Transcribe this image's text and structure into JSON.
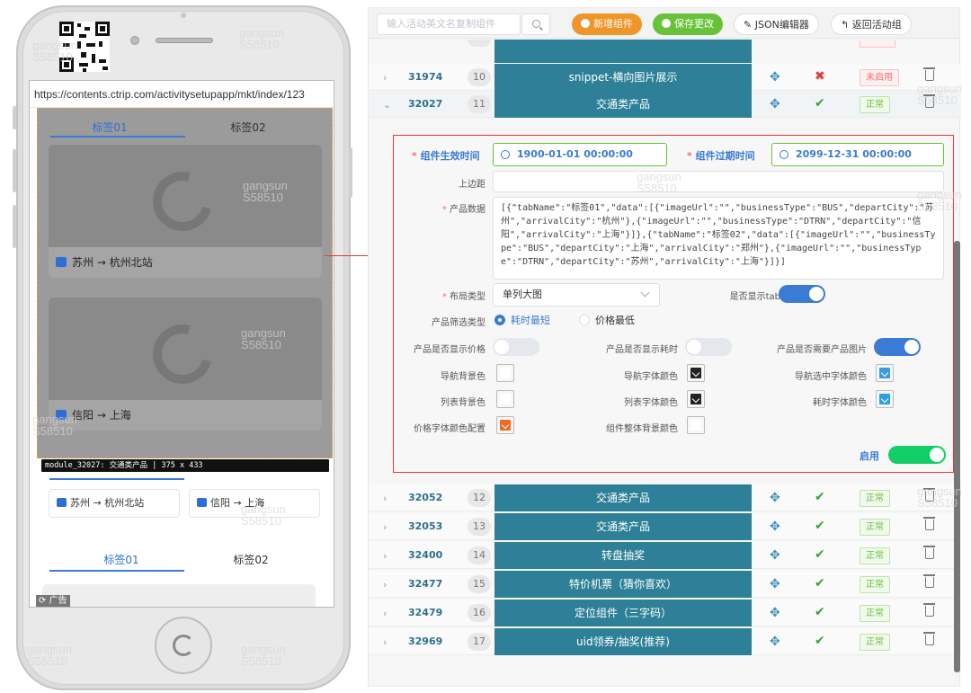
{
  "phone": {
    "url": "https://contents.ctrip.com/activitysetupapp/mkt/index/123",
    "module_tabs": [
      "标签01",
      "标签02"
    ],
    "cards": [
      {
        "from": "苏州",
        "arrow": "→",
        "to": "杭州北站"
      },
      {
        "from": "信阳",
        "arrow": "→",
        "to": "上海"
      }
    ],
    "tooltip": "module_32027: 交通类产品 | 375 x 433",
    "route_cards": [
      {
        "from": "苏州",
        "arrow": "→",
        "to": "杭州北站"
      },
      {
        "from": "信阳",
        "arrow": "→",
        "to": "上海"
      }
    ],
    "lower_tabs": [
      "标签01",
      "标签02"
    ],
    "ad_label": "广告"
  },
  "toolbar": {
    "search_placeholder": "输入活动英文名复制组件",
    "add_label": "新增组件",
    "save_label": "保存更改",
    "json_label": "JSON编辑器",
    "back_label": "返回活动组"
  },
  "rows_top": [
    {
      "id": "31974",
      "index": "10",
      "title": "snippet-横向图片展示",
      "state": "✖",
      "status": "未启用",
      "chev": "›"
    },
    {
      "id": "32027",
      "index": "11",
      "title": "交通类产品",
      "state": "✔",
      "status": "正常",
      "chev": "⌄"
    }
  ],
  "rows_bottom": [
    {
      "id": "32052",
      "index": "12",
      "title": "交通类产品",
      "state": "✔",
      "status": "正常",
      "chev": "›"
    },
    {
      "id": "32053",
      "index": "13",
      "title": "交通类产品",
      "state": "✔",
      "status": "正常",
      "chev": "›"
    },
    {
      "id": "32400",
      "index": "14",
      "title": "转盘抽奖",
      "state": "✔",
      "status": "正常",
      "chev": "›"
    },
    {
      "id": "32477",
      "index": "15",
      "title": "特价机票（猜你喜欢）",
      "state": "✔",
      "status": "正常",
      "chev": "›"
    },
    {
      "id": "32479",
      "index": "16",
      "title": "定位组件（三字码）",
      "state": "✔",
      "status": "正常",
      "chev": "›"
    },
    {
      "id": "32969",
      "index": "17",
      "title": "uid领券/抽奖(推荐)",
      "state": "✔",
      "status": "正常",
      "chev": "›"
    }
  ],
  "move_icon": "✥",
  "editor": {
    "start_label": "组件生效时间",
    "start_value": "1900-01-01 00:00:00",
    "end_label": "组件过期时间",
    "end_value": "2099-12-31 00:00:00",
    "margin_label": "上边距",
    "data_label": "产品数据",
    "data_value": "[{\"tabName\":\"标签01\",\"data\":[{\"imageUrl\":\"\",\"businessType\":\"BUS\",\"departCity\":\"苏州\",\"arrivalCity\":\"杭州\"},{\"imageUrl\":\"\",\"businessType\":\"DTRN\",\"departCity\":\"信阳\",\"arrivalCity\":\"上海\"}]},{\"tabName\":\"标签02\",\"data\":[{\"imageUrl\":\"\",\"businessType\":\"BUS\",\"departCity\":\"上海\",\"arrivalCity\":\"郑州\"},{\"imageUrl\":\"\",\"businessType\":\"DTRN\",\"departCity\":\"苏州\",\"arrivalCity\":\"上海\"}]}]",
    "layout_label": "布局类型",
    "layout_value": "单列大图",
    "show_tab_label": "是否显示tab",
    "show_tab_on": true,
    "filter_label": "产品筛选类型",
    "filter_options": [
      "耗时最短",
      "价格最低"
    ],
    "filter_selected": "耗时最短",
    "show_price_label": "产品是否显示价格",
    "show_time_label": "产品是否显示耗时",
    "need_image_label": "产品是否需要产品图片",
    "nav_bg_label": "导航背景色",
    "nav_font_label": "导航字体颜色",
    "nav_selected_font_label": "导航选中字体颜色",
    "list_bg_label": "列表背景色",
    "list_font_label": "列表字体颜色",
    "time_font_label": "耗时字体颜色",
    "price_font_label": "价格字体颜色配置",
    "module_bg_label": "组件整体背景颜色",
    "enable_label": "启用",
    "colors": {
      "nav_bg": "#ffffff",
      "nav_font": "#222222",
      "nav_selected_font": "#3a9be0",
      "list_bg": "#ffffff",
      "list_font": "#222222",
      "time_font": "#2a9ee6",
      "price_font": "#f06a22",
      "module_bg": "#ffffff"
    }
  },
  "watermark": "gangsun\nS58510"
}
